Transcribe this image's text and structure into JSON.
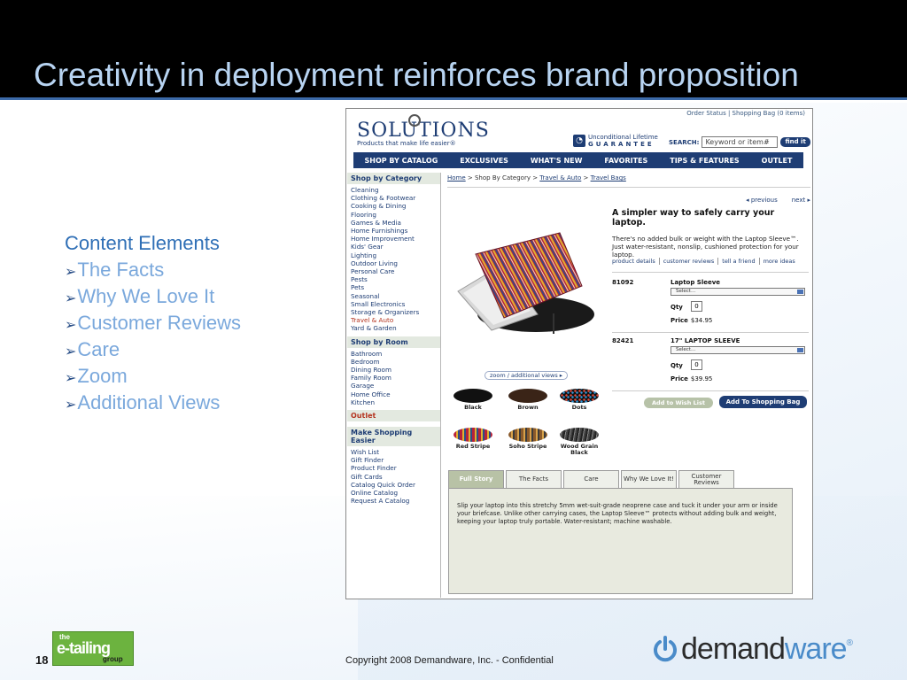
{
  "slide": {
    "title": "Creativity in deployment reinforces brand proposition",
    "number": "18",
    "copyright": "Copyright 2008 Demandware, Inc. - Confidential"
  },
  "content_elements": {
    "heading": "Content Elements",
    "items": [
      "The Facts",
      "Why We Love It",
      "Customer Reviews",
      "Care",
      "Zoom",
      "Additional Views"
    ]
  },
  "etailing_logo": {
    "the": "the",
    "main": "e-tailing",
    "group": "group"
  },
  "demandware_logo": {
    "part1": "demand",
    "part2": "ware",
    "reg": "®"
  },
  "site": {
    "top_links": "Order Status | Shopping Bag  (0 items)",
    "brand": "SOLUTIONS",
    "tagline": "Products that make life easier®",
    "guarantee_line1": "Unconditional Lifetime",
    "guarantee_line2": "GUARANTEE",
    "search_label": "SEARCH:",
    "search_placeholder": "Keyword or item#",
    "search_button": "find it",
    "nav": [
      "SHOP BY CATALOG",
      "EXCLUSIVES",
      "WHAT'S NEW",
      "FAVORITES",
      "TIPS & FEATURES",
      "OUTLET"
    ],
    "sidebar": {
      "category_header": "Shop by Category",
      "categories": [
        "Cleaning",
        "Clothing & Footwear",
        "Cooking & Dining",
        "Flooring",
        "Games & Media",
        "Home Furnishings",
        "Home Improvement",
        "Kids' Gear",
        "Lighting",
        "Outdoor Living",
        "Personal Care",
        "Pests",
        "Pets",
        "Seasonal",
        "Small Electronics",
        "Storage & Organizers",
        "Travel & Auto",
        "Yard & Garden"
      ],
      "room_header": "Shop by Room",
      "rooms": [
        "Bathroom",
        "Bedroom",
        "Dining Room",
        "Family Room",
        "Garage",
        "Home Office",
        "Kitchen"
      ],
      "outlet_header": "Outlet",
      "easier_header": "Make Shopping Easier",
      "easier": [
        "Wish List",
        "Gift Finder",
        "Product Finder",
        "Gift Cards",
        "Catalog Quick Order",
        "Online Catalog",
        "Request A Catalog"
      ]
    },
    "breadcrumb": {
      "home": "Home",
      "sep1": " > Shop By Category > ",
      "travel": "Travel & Auto",
      "sep2": " > ",
      "bags": "Travel Bags"
    },
    "prev": "◂ previous",
    "next": "next ▸",
    "zoom_link": "zoom / additional views ▸",
    "swatches": [
      {
        "name": "Black",
        "color": "#111111"
      },
      {
        "name": "Brown",
        "color": "#3a2417"
      },
      {
        "name": "Dots",
        "color": "#1a1a2e"
      },
      {
        "name": "Red Stripe",
        "color": "#c0392b"
      },
      {
        "name": "Soho Stripe",
        "color": "#8a5a2b"
      },
      {
        "name": "Wood Grain Black",
        "color": "#555555"
      }
    ],
    "product": {
      "headline": "A simpler way to safely carry your laptop.",
      "description": "There's no added bulk or weight with the Laptop Sleeve™. Just water-resistant, nonslip, cushioned protection for your laptop.",
      "links": [
        "product details",
        "customer reviews",
        "tell a friend",
        "more ideas"
      ]
    },
    "items": [
      {
        "sku": "81092",
        "name": "Laptop Sleeve",
        "select": "Select...",
        "qty_label": "Qty",
        "qty": "0",
        "price_label": "Price",
        "price": "$34.95"
      },
      {
        "sku": "82421",
        "name": "17\" LAPTOP SLEEVE",
        "select": "Select...",
        "qty_label": "Qty",
        "qty": "0",
        "price_label": "Price",
        "price": "$39.95"
      }
    ],
    "wish_button": "Add to Wish List",
    "bag_button": "Add To Shopping Bag",
    "tabs": [
      "Full Story",
      "The Facts",
      "Care",
      "Why We Love It!",
      "Customer Reviews"
    ],
    "full_story": "Slip your laptop into this stretchy 5mm wet-suit-grade neoprene case and tuck it under your arm or inside your briefcase. Unlike other carrying cases, the Laptop Sleeve™ protects without adding bulk and weight, keeping your laptop truly portable. Water-resistant; machine washable."
  }
}
